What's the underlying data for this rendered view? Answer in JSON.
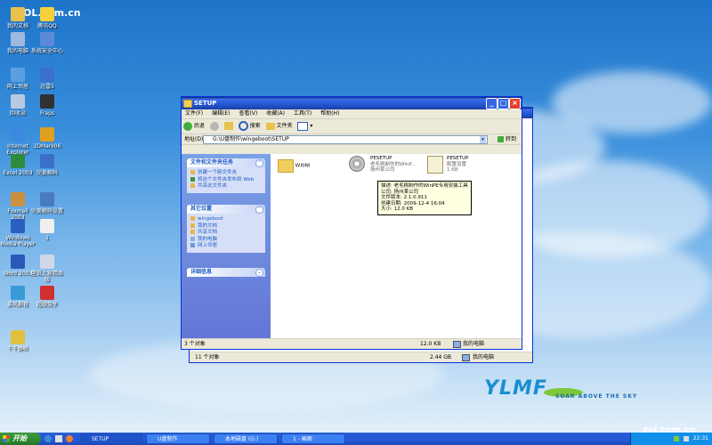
{
  "watermark": {
    "top_left": "ZOL.com.cn",
    "bottom_right": "zol.com.cn"
  },
  "desktop_icons": [
    {
      "label": "我的文档",
      "color": "#e9c24d"
    },
    {
      "label": "腾讯QQ",
      "color": "#f5d13a"
    },
    {
      "label": "我的电脑",
      "color": "#9fb8de"
    },
    {
      "label": "系统安全中心",
      "color": "#5c8ad8"
    },
    {
      "label": "网上邻居",
      "color": "#5aa0e0"
    },
    {
      "label": "迅雷5",
      "color": "#3b6fd0"
    },
    {
      "label": "回收站",
      "color": "#b9c9e2"
    },
    {
      "label": "Fraps",
      "color": "#303030"
    },
    {
      "label": "Internet Explorer",
      "color": "#3b8ae0"
    },
    {
      "label": "3DMark06",
      "color": "#e0a020"
    },
    {
      "label": "Excel 2003",
      "color": "#2e8b3e"
    },
    {
      "label": "完美解码",
      "color": "#3a70c8"
    },
    {
      "label": "Foxmail 2003",
      "color": "#c89040"
    },
    {
      "label": "完美解码设置",
      "color": "#4a7ac0"
    },
    {
      "label": "Windows Media Player",
      "color": "#2a5fbf"
    },
    {
      "label": "1",
      "color": "#f0f0f0"
    },
    {
      "label": "Word 2003",
      "color": "#2a58b8"
    },
    {
      "label": "壁纸之家精品版",
      "color": "#d0d8e8"
    },
    {
      "label": "暴风影音",
      "color": "#3a9ad8"
    },
    {
      "label": "超级兔子",
      "color": "#d03030"
    },
    {
      "label": "千千静听",
      "color": "#e0c040"
    }
  ],
  "window": {
    "title": "SETUP",
    "menu": [
      "文件(F)",
      "编辑(E)",
      "查看(V)",
      "收藏(A)",
      "工具(T)",
      "帮助(H)"
    ],
    "toolbar": {
      "back": "后退",
      "search": "搜索",
      "folders": "文件夹"
    },
    "address_label": "地址(D)",
    "address_value": "G:\\U盘制作\\wingeboot\\SETUP",
    "go_label": "转到",
    "file_tasks": {
      "title": "文件和文件夹任务",
      "items": [
        "创建一个新文件夹",
        "将这个文件夹发布到 Web",
        "共享此文件夹"
      ]
    },
    "other_places": {
      "title": "其它位置",
      "items": [
        "wingeboot",
        "我的文档",
        "共享文档",
        "我的电脑",
        "网上邻居"
      ]
    },
    "details": {
      "title": "详细信息"
    },
    "files": [
      {
        "name": "WXINI",
        "lines": []
      },
      {
        "name": "PESETUP",
        "lines": [
          "老毛桃制作的WinP...",
          "扬州某公司"
        ]
      },
      {
        "name": "PESETUP",
        "lines": [
          "配置设置",
          "1 KB"
        ]
      }
    ],
    "tooltip": [
      "描述: 老毛桃制作的WinPE专用安装工具",
      "公司: 扬州某公司",
      "文件版本: 2.1.0.911",
      "创建日期: 2009-12-4 16:04",
      "大小: 12.0 KB"
    ],
    "status": {
      "objects": "3 个对象",
      "size": "12.0 KB",
      "location": "我的电脑"
    }
  },
  "back_window": {
    "status": {
      "objects": "11 个对象",
      "size": "2.44 GB",
      "location": "我的电脑"
    }
  },
  "logo": {
    "text": "YLMF",
    "tagline": "SOAR ABOVE THE SKY"
  },
  "taskbar": {
    "start_label": "开始",
    "tasks": [
      "SETUP",
      "U盘制作",
      "本地磁盘 (G:)",
      "1 - 画图"
    ],
    "time": "22:31"
  }
}
